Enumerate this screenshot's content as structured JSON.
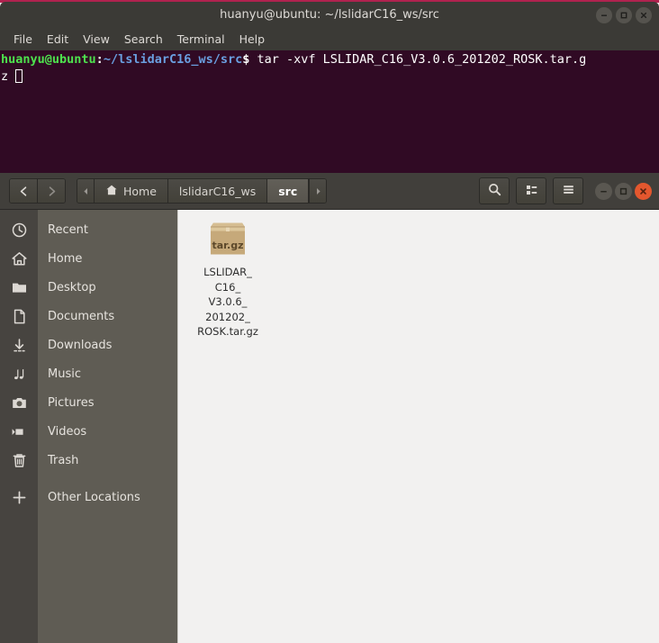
{
  "terminal": {
    "title": "huanyu@ubuntu: ~/lslidarC16_ws/src",
    "menu": [
      {
        "label": "File"
      },
      {
        "label": "Edit"
      },
      {
        "label": "View"
      },
      {
        "label": "Search"
      },
      {
        "label": "Terminal"
      },
      {
        "label": "Help"
      }
    ],
    "prompt_user": "huanyu@ubuntu",
    "prompt_colon": ":",
    "prompt_path": "~/lslidarC16_ws/src",
    "prompt_sigil": "$",
    "command": " tar -xvf LSLIDAR_C16_V3.0.6_201202_ROSK.tar.g",
    "wrapped_remainder": "z ",
    "colors": {
      "background": "#300a24",
      "titlebar": "#3b3a36",
      "accent_line": "#b0224f",
      "user_green": "#4ee24e",
      "path_blue": "#6a9fe0"
    },
    "window_buttons": [
      {
        "name": "minimize"
      },
      {
        "name": "maximize"
      },
      {
        "name": "close"
      }
    ]
  },
  "file_manager": {
    "nav": {
      "back_label": "Back",
      "forward_label": "Forward"
    },
    "breadcrumbs": [
      {
        "label": "Home",
        "icon": "home-icon",
        "active": false
      },
      {
        "label": "lslidarC16_ws",
        "icon": "",
        "active": false
      },
      {
        "label": "src",
        "icon": "",
        "active": true
      }
    ],
    "toolbar": [
      {
        "name": "search-icon",
        "label": "Search"
      },
      {
        "name": "view-list-icon",
        "label": "View options"
      },
      {
        "name": "menu-icon",
        "label": "Menu"
      }
    ],
    "window_buttons": [
      {
        "name": "minimize"
      },
      {
        "name": "maximize"
      },
      {
        "name": "close"
      }
    ],
    "sidebar": {
      "items": [
        {
          "label": "Recent",
          "icon": "clock-icon"
        },
        {
          "label": "Home",
          "icon": "home-icon"
        },
        {
          "label": "Desktop",
          "icon": "folder-icon"
        },
        {
          "label": "Documents",
          "icon": "document-icon"
        },
        {
          "label": "Downloads",
          "icon": "download-icon"
        },
        {
          "label": "Music",
          "icon": "music-icon"
        },
        {
          "label": "Pictures",
          "icon": "camera-icon"
        },
        {
          "label": "Videos",
          "icon": "video-icon"
        },
        {
          "label": "Trash",
          "icon": "trash-icon"
        }
      ],
      "other": {
        "label": "Other Locations",
        "icon": "plus-icon"
      }
    },
    "files": [
      {
        "name": "LSLIDAR_C16_V3.0.6_201202_ROSK.tar.gz",
        "display_name": "LSLIDAR_\nC16_\nV3.0.6_\n201202_\nROSK.tar.gz",
        "icon": "archive-icon",
        "icon_label": "tar.gz"
      }
    ],
    "colors": {
      "headerbar": "#413f3b",
      "sidebar": "#5f5c54",
      "sidebar_strip": "#474440",
      "content": "#f2f1f0",
      "close_button": "#e4572e"
    }
  }
}
